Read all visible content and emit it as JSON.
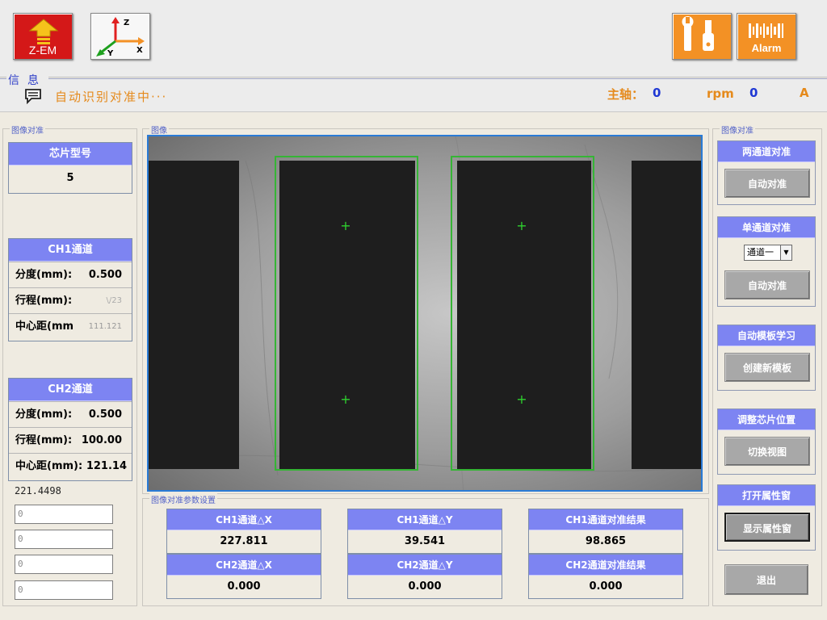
{
  "toolbar": {
    "zem_label": "Z-EM",
    "axes_z": "Z",
    "axes_y": "Y",
    "axes_x": "X",
    "alarm_label": "Alarm"
  },
  "info": {
    "legend": "信息",
    "message": "自动识别对准中···",
    "spindle_label": "主轴：",
    "spindle_value": "0",
    "rpm_label": "rpm",
    "rpm_value": "0",
    "amp_label": "A"
  },
  "left": {
    "legend": "图像对准",
    "chip_model": {
      "title": "芯片型号",
      "value": "5"
    },
    "ch1": {
      "title": "CH1通道",
      "rows": [
        {
          "k": "分度(mm):",
          "v": "0.500"
        },
        {
          "k": "行程(mm):",
          "v": "\\/23"
        },
        {
          "k": "中心距(mm",
          "v": "111.121"
        }
      ]
    },
    "ch2": {
      "title": "CH2通道",
      "rows": [
        {
          "k": "分度(mm):",
          "v": "0.500"
        },
        {
          "k": "行程(mm):",
          "v": "100.00"
        },
        {
          "k": "中心距(mm):",
          "v": "121.14"
        }
      ]
    },
    "readout": "221.4498",
    "inputs": [
      "0",
      "0",
      "0",
      "0"
    ]
  },
  "viewer": {
    "legend": "图像"
  },
  "params": {
    "legend": "图像对准参数设置",
    "cells": [
      {
        "head": "CH1通道△X",
        "value": "227.811"
      },
      {
        "head": "CH1通道△Y",
        "value": "39.541"
      },
      {
        "head": "CH1通道对准结果",
        "value": "98.865"
      },
      {
        "head": "CH2通道△X",
        "value": "0.000"
      },
      {
        "head": "CH2通道△Y",
        "value": "0.000"
      },
      {
        "head": "CH2通道对准结果",
        "value": "0.000"
      }
    ]
  },
  "right": {
    "legend": "图像对准",
    "dual": {
      "title": "两通道对准",
      "button": "自动对准"
    },
    "single": {
      "title": "单通道对准",
      "select": "通道一",
      "button": "自动对准"
    },
    "template": {
      "title": "自动模板学习",
      "button": "创建新模板"
    },
    "adjust": {
      "title": "调整芯片位置",
      "button": "切换视图"
    },
    "props": {
      "title": "打开属性窗",
      "button": "显示属性窗"
    },
    "exit_button": "退出"
  },
  "colors": {
    "panel_header": "#7d84f2",
    "accent_orange": "#f39125",
    "value_blue": "#1f38d4",
    "roi_green": "#35b535"
  }
}
